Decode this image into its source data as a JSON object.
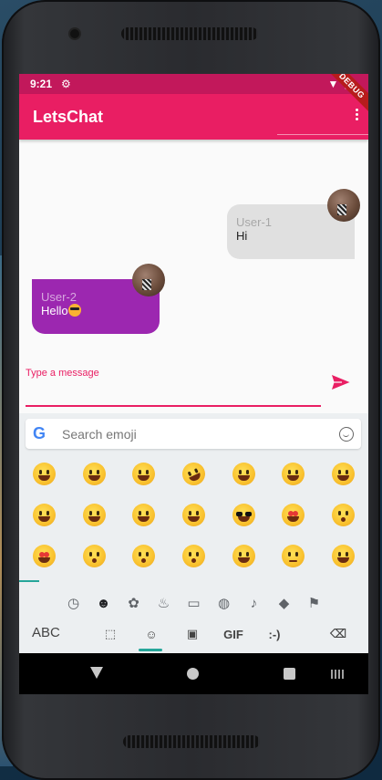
{
  "status_bar": {
    "time": "9:21",
    "debug_banner": "DEBUG"
  },
  "app_bar": {
    "title": "LetsChat"
  },
  "messages": [
    {
      "user": "User-1",
      "text": "Hi"
    },
    {
      "user": "User-2",
      "text": "Hello"
    }
  ],
  "composer": {
    "label": "Type a message"
  },
  "emoji_keyboard": {
    "search_placeholder": "Search emoji",
    "google_logo": "G",
    "bottom_abc": "ABC",
    "bottom_gif": "GIF",
    "bottom_emoticon": ":-)"
  },
  "colors": {
    "accent": "#e91e63",
    "status_bar": "#c2185b",
    "user2_bubble": "#9c27b0",
    "user1_bubble": "#e0e0e0",
    "keyboard_highlight": "#26a69a"
  }
}
